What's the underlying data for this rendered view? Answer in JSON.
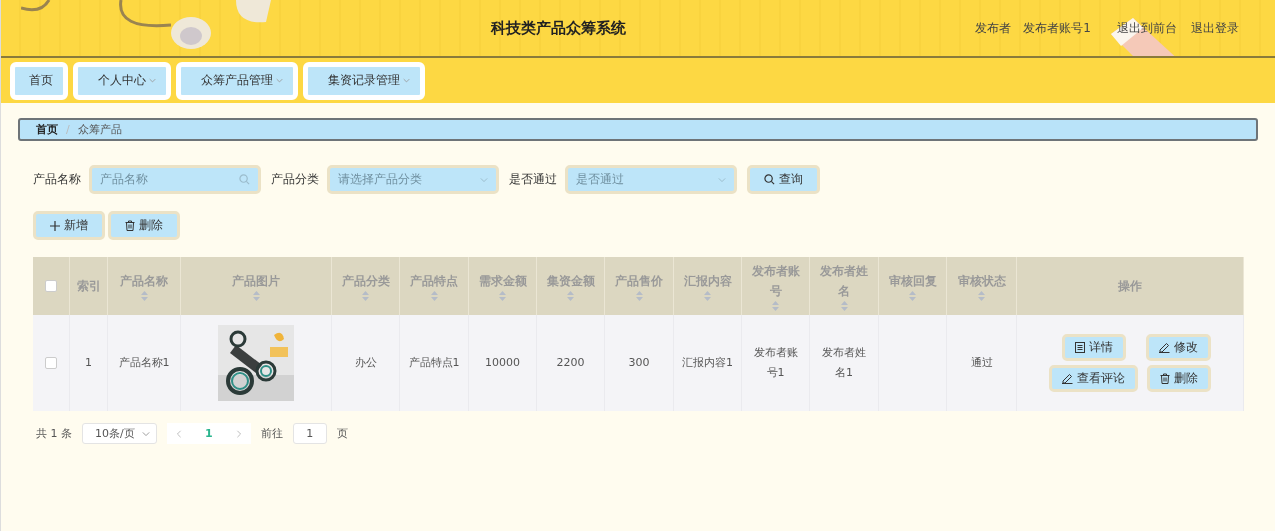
{
  "header": {
    "title": "科技类产品众筹系统",
    "user_role": "发布者",
    "username": "发布者账号1",
    "links": [
      "退出到前台",
      "退出登录"
    ]
  },
  "nav": [
    {
      "label": "首页",
      "caret": false
    },
    {
      "label": "个人中心",
      "caret": true
    },
    {
      "label": "众筹产品管理",
      "caret": true
    },
    {
      "label": "集资记录管理",
      "caret": true
    }
  ],
  "breadcrumb": {
    "items": [
      "首页",
      "众筹产品"
    ],
    "separator": "/"
  },
  "filters": [
    {
      "label": "产品名称",
      "placeholder": "产品名称",
      "kind": "search"
    },
    {
      "label": "产品分类",
      "placeholder": "请选择产品分类",
      "kind": "select"
    },
    {
      "label": "是否通过",
      "placeholder": "是否通过",
      "kind": "select"
    }
  ],
  "search_button": "查询",
  "actions": [
    {
      "label": "新增",
      "kind": "add"
    },
    {
      "label": "删除",
      "kind": "delete"
    }
  ],
  "table": {
    "select_all": {
      "checked": false
    },
    "columns": [
      {
        "kind": "check"
      },
      {
        "label": "索引",
        "kind": "text",
        "sortable": false
      },
      {
        "label": "产品名称",
        "kind": "text",
        "sortable": true
      },
      {
        "label": "产品图片",
        "kind": "picture",
        "sortable": true
      },
      {
        "label": "产品分类",
        "kind": "text",
        "sortable": true
      },
      {
        "label": "产品特点",
        "kind": "text",
        "sortable": true
      },
      {
        "label": "需求金额",
        "kind": "text",
        "sortable": true
      },
      {
        "label": "集资金额",
        "kind": "text",
        "sortable": true
      },
      {
        "label": "产品售价",
        "kind": "text",
        "sortable": true
      },
      {
        "label": "汇报内容",
        "kind": "text",
        "sortable": true
      },
      {
        "label": "发布者账号",
        "kind": "text",
        "sortable": true
      },
      {
        "label": "发布者姓名",
        "kind": "text",
        "sortable": true
      },
      {
        "label": "审核回复",
        "kind": "text",
        "sortable": true
      },
      {
        "label": "审核状态",
        "kind": "text",
        "sortable": true
      },
      {
        "label": "操作",
        "kind": "actions",
        "sortable": false
      }
    ],
    "rows": [
      {
        "checked": false,
        "cells": [
          null,
          "1",
          "产品名称1",
          null,
          "办公",
          "产品特点1",
          "10000",
          "2200",
          "300",
          "汇报内容1",
          "发布者账号1",
          "发布者姓名1",
          null,
          "通过",
          null
        ],
        "operations": [
          {
            "label": "详情",
            "kind": "detail"
          },
          {
            "label": "修改",
            "kind": "edit"
          },
          {
            "label": "查看评论",
            "kind": "edit"
          },
          {
            "label": "删除",
            "kind": "delete"
          }
        ]
      }
    ]
  },
  "pagination": {
    "total": "共 1 条",
    "page_size": "10条/页",
    "pages": [
      {
        "label": "1",
        "selected": true
      }
    ],
    "goto_label": "前往",
    "goto_value": "1",
    "goto_suffix": "页"
  }
}
